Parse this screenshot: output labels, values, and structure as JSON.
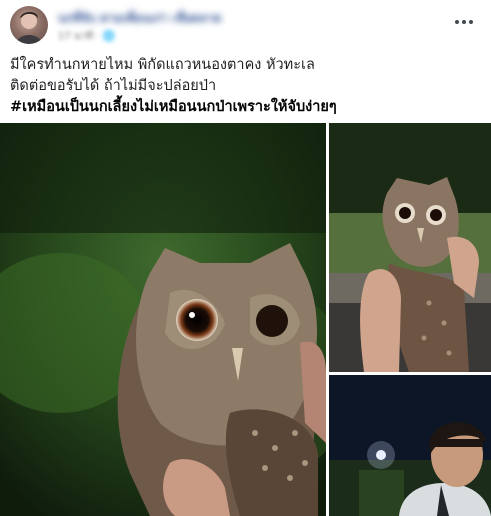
{
  "post": {
    "author_name": "นกที่จับ ตามเพื่อนเก่า เชื่อตลาด",
    "meta": "17 นาที · 🌐",
    "text_lines": [
      "มีใครทำนกหายไหม พิกัดแถวหนองตาคง หัวทะเล",
      "ติดต่อขอรับได้ ถ้าไม่มีจะปล่อยป่า"
    ],
    "hashtag": "#เหมือนเป็นนกเลี้ยงไม่เหมือนนกป่าเพราะให้จับง่ายๆ"
  },
  "icons": {
    "more": "more-horizontal-icon"
  },
  "colors": {
    "author_link": "#385898",
    "meta_text": "#65676b",
    "body_text": "#1c1e21"
  }
}
